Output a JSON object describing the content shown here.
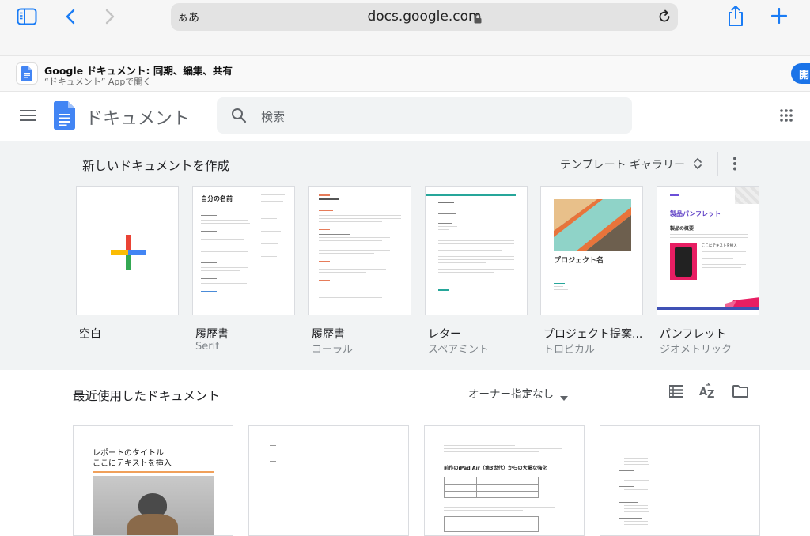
{
  "browser": {
    "aa_label": "ぁあ",
    "url": "docs.google.com"
  },
  "banner": {
    "title": "Google ドキュメント: 同期、編集、共有",
    "subtitle": "“ドキュメント” Appで開く",
    "open_label": "開"
  },
  "header": {
    "app_title": "ドキュメント",
    "search_placeholder": "検索"
  },
  "templates": {
    "heading": "新しいドキュメントを作成",
    "gallery_label": "テンプレート ギャラリー",
    "items": [
      {
        "name": "空白",
        "sub": ""
      },
      {
        "name": "履歴書",
        "sub": "Serif"
      },
      {
        "name": "履歴書",
        "sub": "コーラル"
      },
      {
        "name": "レター",
        "sub": "スペアミント"
      },
      {
        "name": "プロジェクト提案...",
        "sub": "トロピカル"
      },
      {
        "name": "パンフレット",
        "sub": "ジオメトリック"
      }
    ],
    "thumb_text": {
      "resume_name": "自分の名前",
      "project_name": "プロジェクト名",
      "brochure_title": "製品パンフレット",
      "brochure_section": "製品の概要",
      "brochure_note": "ここにテキストを挿入"
    }
  },
  "recent": {
    "heading": "最近使用したドキュメント",
    "owner_filter": "オーナー指定なし",
    "docs": [
      {
        "line1": "レポートのタイトル",
        "line2": "ここにテキストを挿入"
      },
      {},
      {
        "heading": "前作のiPad Air（第3世代）からの大幅な強化"
      },
      {}
    ]
  },
  "colors": {
    "accent": "#1a73e8",
    "safari_blue": "#1a7cf5",
    "docs_blue": "#4285f4"
  }
}
